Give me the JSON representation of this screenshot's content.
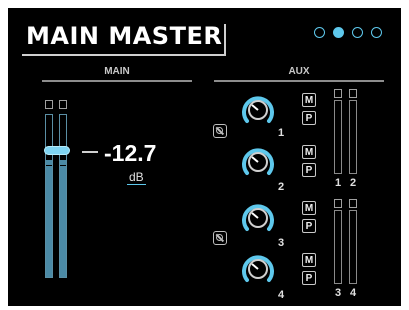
{
  "title": "MAIN MASTER",
  "pages": {
    "count": 4,
    "active_index": 1
  },
  "main": {
    "label": "MAIN",
    "fader_value": "-12.7",
    "unit": "dB",
    "meter_level": 0.72
  },
  "aux": {
    "label": "AUX",
    "channels": [
      {
        "number": "1",
        "mute": "M",
        "pre": "P"
      },
      {
        "number": "2",
        "mute": "M",
        "pre": "P"
      },
      {
        "number": "3",
        "mute": "M",
        "pre": "P"
      },
      {
        "number": "4",
        "mute": "M",
        "pre": "P"
      }
    ],
    "meters": [
      "1",
      "2",
      "3",
      "4"
    ]
  },
  "colors": {
    "accent": "#5ec8ec",
    "meter_fill": "#4b8aa6"
  }
}
